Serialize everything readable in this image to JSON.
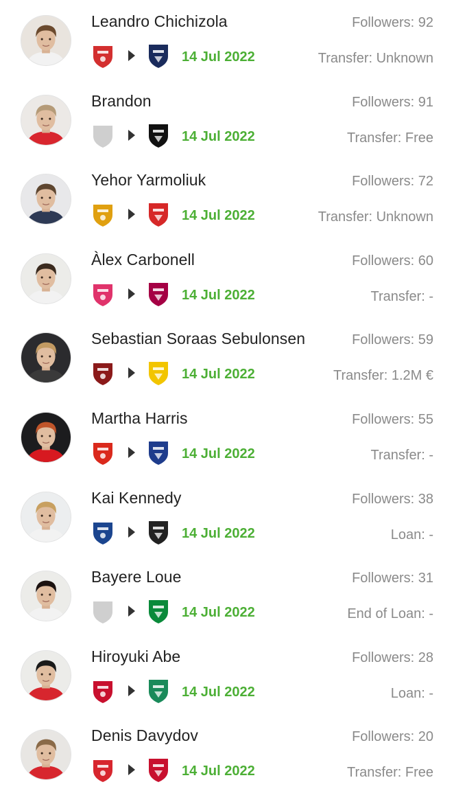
{
  "rows": [
    {
      "name": "Leandro Chichizola",
      "followers": "Followers: 92",
      "date": "14 Jul 2022",
      "transfer": "Transfer: Unknown",
      "avatar_bg": "#e9e4de",
      "hair": "#6b4a2e",
      "shirt": "#f2f2f2",
      "from_crest": "red-shield-crest-icon",
      "from_color": "#d32f2f",
      "to_crest": "parma-crest-icon",
      "to_color": "#1a2b5c"
    },
    {
      "name": "Brandon",
      "followers": "Followers: 91",
      "date": "14 Jul 2022",
      "transfer": "Transfer: Free",
      "avatar_bg": "#ece9e6",
      "hair": "#b59b78",
      "shirt": "#d8262e",
      "from_crest": "unknown-club-shield-icon",
      "from_color": "#cfcfcf",
      "to_crest": "paok-crest-icon",
      "to_color": "#111111"
    },
    {
      "name": "Yehor Yarmoliuk",
      "followers": "Followers: 72",
      "date": "14 Jul 2022",
      "transfer": "Transfer: Unknown",
      "avatar_bg": "#e8e8ea",
      "hair": "#5e4630",
      "shirt": "#2e3a55",
      "from_crest": "dnipro-crest-icon",
      "from_color": "#e0a010",
      "to_crest": "brentford-crest-icon",
      "to_color": "#d62828"
    },
    {
      "name": "Àlex Carbonell",
      "followers": "Followers: 60",
      "date": "14 Jul 2022",
      "transfer": "Transfer: -",
      "avatar_bg": "#ecece9",
      "hair": "#3a2a1e",
      "shirt": "#f2f2f2",
      "from_crest": "celta-crest-icon",
      "from_color": "#e0336b",
      "to_crest": "barcelona-crest-icon",
      "to_color": "#a50044"
    },
    {
      "name": "Sebastian Soraas Sebulonsen",
      "followers": "Followers: 59",
      "date": "14 Jul 2022",
      "transfer": "Transfer: 1.2M €",
      "avatar_bg": "#2b2b2e",
      "hair": "#c29a62",
      "shirt": "#3a3a3a",
      "from_crest": "viking-crest-icon",
      "from_color": "#8b1a1a",
      "to_crest": "brondby-crest-icon",
      "to_color": "#f2c500"
    },
    {
      "name": "Martha Harris",
      "followers": "Followers: 55",
      "date": "14 Jul 2022",
      "transfer": "Transfer: -",
      "avatar_bg": "#1c1c1e",
      "hair": "#c0552a",
      "shirt": "#d71920",
      "from_crest": "man-utd-crest-icon",
      "from_color": "#da291c",
      "to_crest": "birmingham-crest-icon",
      "to_color": "#1e3c8c"
    },
    {
      "name": "Kai Kennedy",
      "followers": "Followers: 38",
      "date": "14 Jul 2022",
      "transfer": "Loan: -",
      "avatar_bg": "#eceeef",
      "hair": "#c8a060",
      "shirt": "#f2f2f2",
      "from_crest": "rangers-crest-icon",
      "from_color": "#1b458f",
      "to_crest": "falkirk-crest-icon",
      "to_color": "#222222"
    },
    {
      "name": "Bayere Loue",
      "followers": "Followers: 31",
      "date": "14 Jul 2022",
      "transfer": "End of Loan: -",
      "avatar_bg": "#ecece9",
      "hair": "#1b1210",
      "shirt": "#f2f2f2",
      "from_crest": "unknown-club-shield-icon",
      "from_color": "#cfcfcf",
      "to_crest": "hammarby-crest-icon",
      "to_color": "#0a8a3a"
    },
    {
      "name": "Hiroyuki Abe",
      "followers": "Followers: 28",
      "date": "14 Jul 2022",
      "transfer": "Loan: -",
      "avatar_bg": "#ecece9",
      "hair": "#1a1a1a",
      "shirt": "#d7262e",
      "from_crest": "nagoya-crest-icon",
      "from_color": "#c8102e",
      "to_crest": "shonan-crest-icon",
      "to_color": "#1a8a5a"
    },
    {
      "name": "Denis Davydov",
      "followers": "Followers: 20",
      "date": "14 Jul 2022",
      "transfer": "Transfer: Free",
      "avatar_bg": "#e8e6e3",
      "hair": "#8a6a48",
      "shirt": "#d7262e",
      "from_crest": "red-white-crest-icon",
      "from_color": "#d7262e",
      "to_crest": "red-black-crest-icon",
      "to_color": "#c8102e"
    }
  ]
}
